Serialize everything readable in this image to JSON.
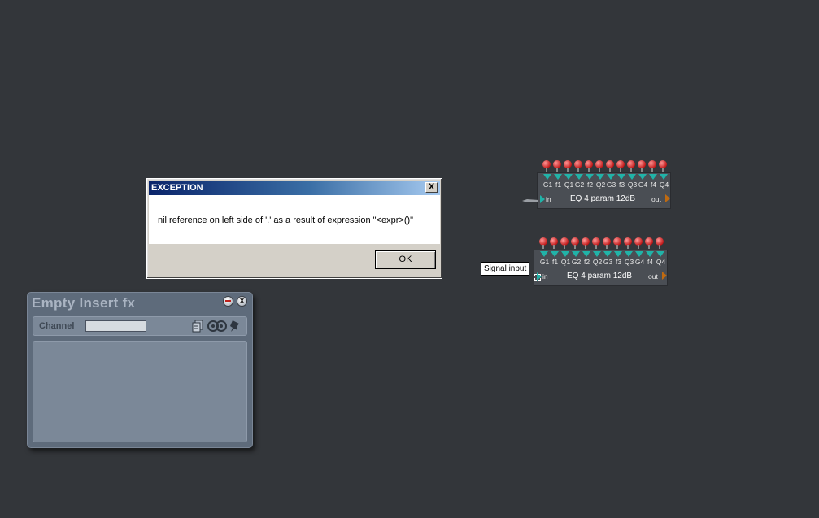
{
  "dialog": {
    "title": "EXCEPTION",
    "close_glyph": "X",
    "message": "nil reference on left side of '.' as a result of expression \"<expr>()\"",
    "ok_label": "OK"
  },
  "eq_modules": [
    {
      "param_labels": [
        "G1",
        "f1",
        "Q1",
        "G2",
        "f2",
        "Q2",
        "G3",
        "f3",
        "Q3",
        "G4",
        "f4",
        "Q4"
      ],
      "in_label": "in",
      "name": "EQ 4 param 12dB",
      "out_label": "out"
    },
    {
      "param_labels": [
        "G1",
        "f1",
        "Q1",
        "G2",
        "f2",
        "Q2",
        "G3",
        "f3",
        "Q3",
        "G4",
        "f4",
        "Q4"
      ],
      "in_label": "in",
      "name": "EQ 4 param 12dB",
      "out_label": "out"
    }
  ],
  "tooltip": {
    "text": "Signal input"
  },
  "insert_panel": {
    "title": "Empty Insert fx",
    "close_glyph": "X",
    "channel_label": "Channel",
    "channel_value": "",
    "icons": [
      "copy-icon",
      "link-icon",
      "pin-icon"
    ]
  },
  "colors": {
    "background": "#33363a",
    "knob": "#c01818",
    "port_in": "#21b3a8",
    "port_out": "#c06a10",
    "panel": "#5e6b7b"
  }
}
